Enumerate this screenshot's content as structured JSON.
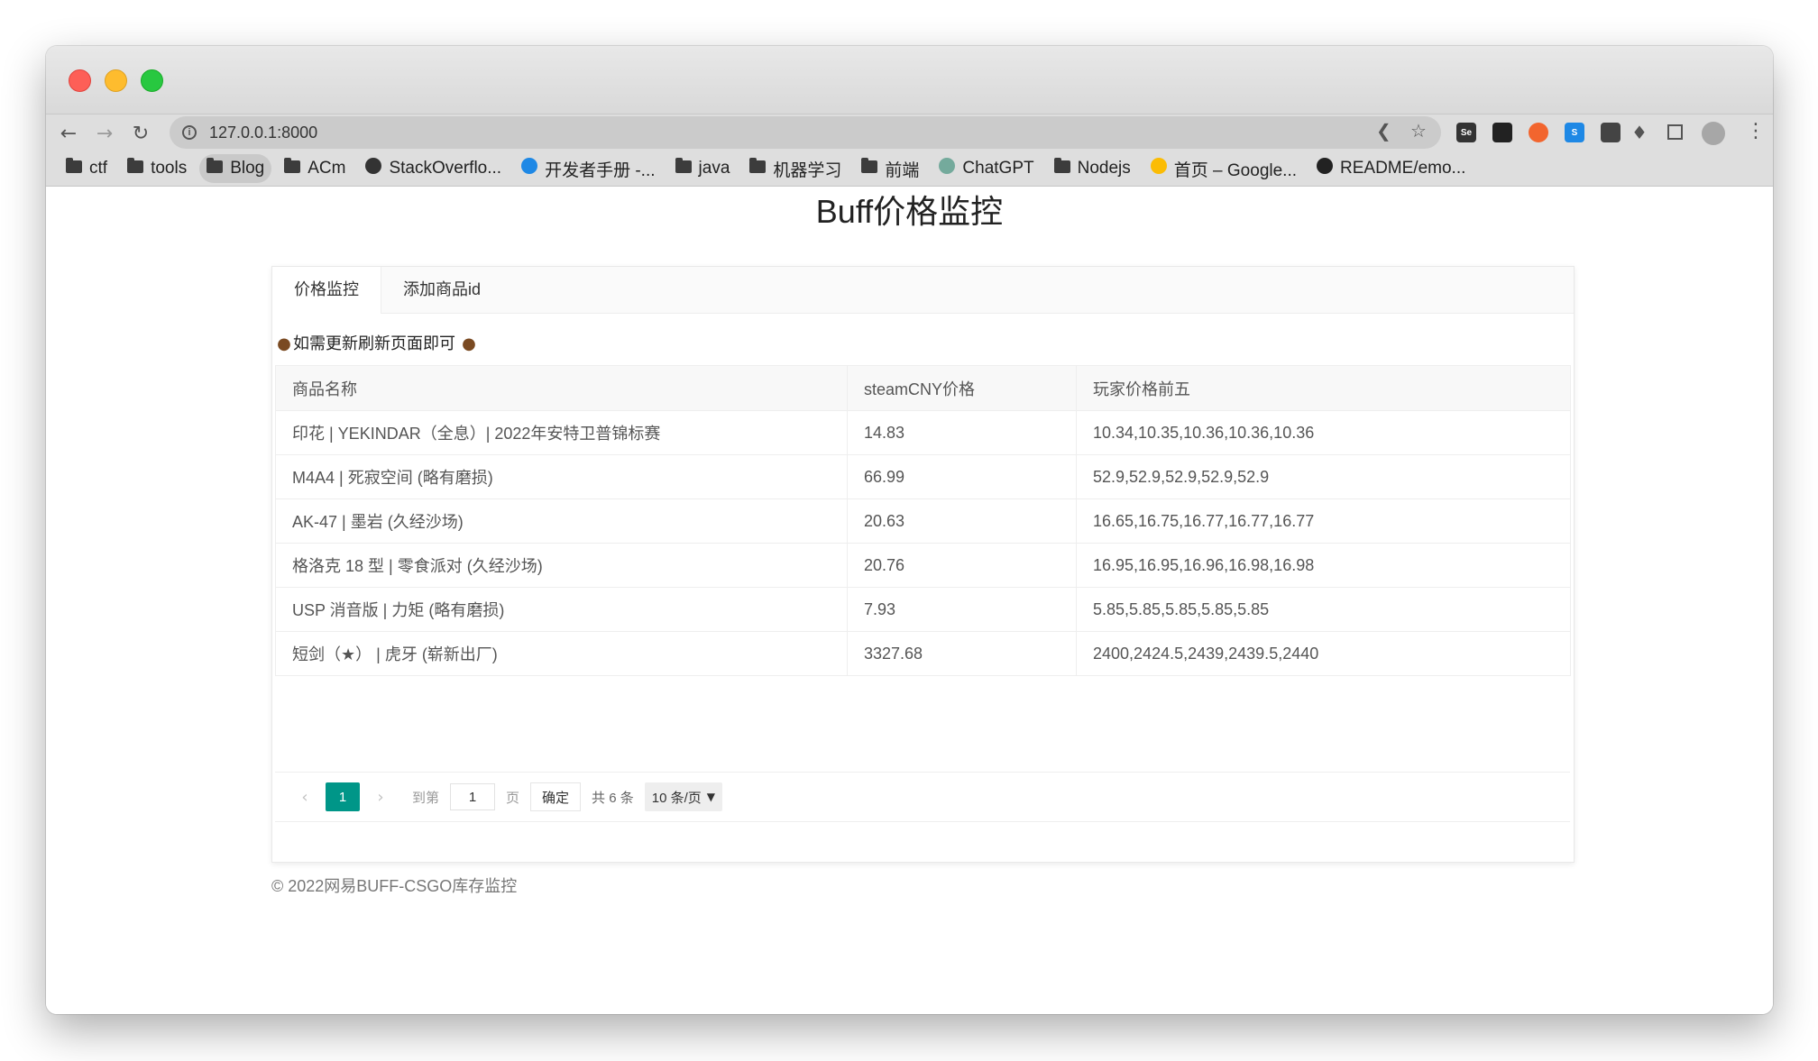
{
  "browser": {
    "url": "127.0.0.1:8000",
    "bookmarks": [
      {
        "label": "ctf",
        "icon": "folder-icon"
      },
      {
        "label": "tools",
        "icon": "folder-icon"
      },
      {
        "label": "Blog",
        "icon": "folder-icon"
      },
      {
        "label": "ACm",
        "icon": "folder-icon"
      },
      {
        "label": "StackOverflo...",
        "icon": "stackoverflow-icon"
      },
      {
        "label": "开发者手册 -...",
        "icon": "cloud-icon"
      },
      {
        "label": "java",
        "icon": "folder-icon"
      },
      {
        "label": "机器学习",
        "icon": "folder-icon"
      },
      {
        "label": "前端",
        "icon": "folder-icon"
      },
      {
        "label": "ChatGPT",
        "icon": "chatgpt-icon"
      },
      {
        "label": "Nodejs",
        "icon": "folder-icon"
      },
      {
        "label": "首页 – Google...",
        "icon": "google-ads-icon"
      },
      {
        "label": "README/emo...",
        "icon": "github-icon"
      }
    ],
    "extensions": [
      {
        "label": "Se",
        "color": "#333333"
      },
      {
        "label": "",
        "color": "#222222"
      },
      {
        "label": "",
        "color": "#f2652e"
      },
      {
        "label": "S",
        "color": "#1e88e5"
      },
      {
        "label": "",
        "color": "#444444"
      },
      {
        "label": "",
        "color": "#1e88e5"
      }
    ]
  },
  "page": {
    "title": "Buff价格监控",
    "tabs": [
      {
        "label": "价格监控",
        "active": true
      },
      {
        "label": "添加商品id",
        "active": false
      }
    ],
    "notice": "如需更新刷新页面即可",
    "table": {
      "headers": [
        "商品名称",
        "steamCNY价格",
        "玩家价格前五"
      ],
      "rows": [
        [
          "印花 | YEKINDAR（全息）| 2022年安特卫普锦标赛",
          "14.83",
          "10.34,10.35,10.36,10.36,10.36"
        ],
        [
          "M4A4 | 死寂空间 (略有磨损)",
          "66.99",
          "52.9,52.9,52.9,52.9,52.9"
        ],
        [
          "AK-47 | 墨岩 (久经沙场)",
          "20.63",
          "16.65,16.75,16.77,16.77,16.77"
        ],
        [
          "格洛克 18 型 | 零食派对 (久经沙场)",
          "20.76",
          "16.95,16.95,16.96,16.98,16.98"
        ],
        [
          "USP 消音版 | 力矩 (略有磨损)",
          "7.93",
          "5.85,5.85,5.85,5.85,5.85"
        ],
        [
          "短剑（★） | 虎牙 (崭新出厂)",
          "3327.68",
          "2400,2424.5,2439,2439.5,2440"
        ]
      ]
    },
    "pagination": {
      "current": "1",
      "goto_label": "到第",
      "goto_value": "1",
      "page_label": "页",
      "confirm_label": "确定",
      "total_label": "共 6 条",
      "page_size": "10 条/页"
    },
    "footer": "© 2022网易BUFF-CSGO库存监控"
  },
  "colors": {
    "accent": "#009688",
    "traffic_close": "#fd5f57",
    "traffic_min": "#febc2e",
    "traffic_max": "#28c840"
  }
}
